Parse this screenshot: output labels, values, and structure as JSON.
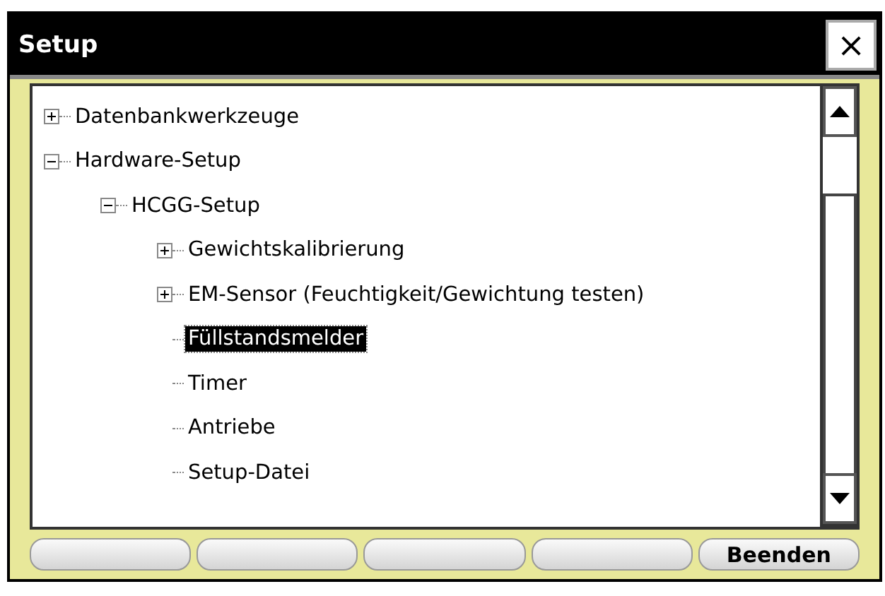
{
  "window": {
    "title": "Setup",
    "close": "×"
  },
  "tree": [
    {
      "label": "Datenbankwerkzeuge",
      "expanded": false,
      "selected": false
    },
    {
      "label": "Hardware-Setup",
      "expanded": true,
      "selected": false,
      "children": [
        {
          "label": "HCGG-Setup",
          "expanded": true,
          "selected": false,
          "children": [
            {
              "label": "Gewichtskalibrierung",
              "expanded": false,
              "selected": false
            },
            {
              "label": "EM-Sensor (Feuchtigkeit/Gewichtung testen)",
              "expanded": false,
              "selected": false
            },
            {
              "label": "Füllstandsmelder",
              "selected": true
            },
            {
              "label": "Timer",
              "selected": false
            },
            {
              "label": "Antriebe",
              "selected": false
            },
            {
              "label": "Setup-Datei",
              "selected": false
            }
          ]
        }
      ]
    }
  ],
  "buttons": [
    {
      "kind": "blank"
    },
    {
      "kind": "blank"
    },
    {
      "kind": "blank"
    },
    {
      "kind": "blank"
    },
    {
      "kind": "text",
      "label": "Beenden"
    }
  ]
}
